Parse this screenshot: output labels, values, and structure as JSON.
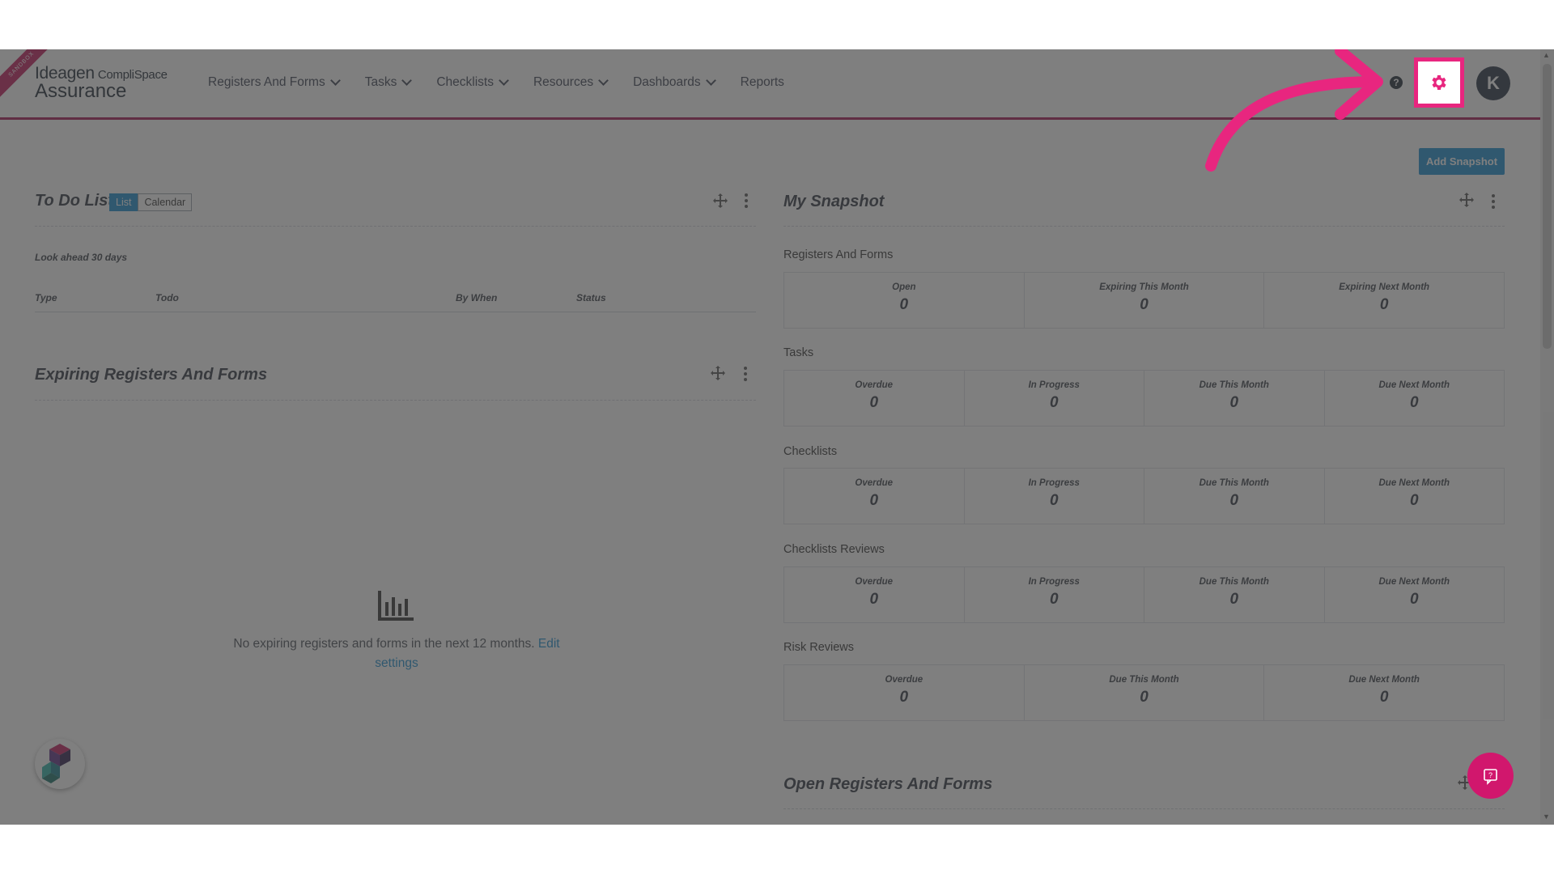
{
  "brand": {
    "sandbox_tag": "SANDBOX",
    "logo_line1": "Ideagen",
    "logo_line1_suffix": "CompliSpace",
    "logo_line2": "Assurance"
  },
  "nav": {
    "items": [
      {
        "label": "Registers And Forms",
        "has_dropdown": true
      },
      {
        "label": "Tasks",
        "has_dropdown": true
      },
      {
        "label": "Checklists",
        "has_dropdown": true
      },
      {
        "label": "Resources",
        "has_dropdown": true
      },
      {
        "label": "Dashboards",
        "has_dropdown": true
      },
      {
        "label": "Reports",
        "has_dropdown": false
      }
    ]
  },
  "header_right": {
    "help_icon": "?",
    "settings_icon": "gear-icon",
    "avatar_initial": "K"
  },
  "actions": {
    "add_snapshot": "Add Snapshot"
  },
  "todo": {
    "title": "To Do List",
    "toggle": [
      {
        "label": "List",
        "active": true
      },
      {
        "label": "Calendar",
        "active": false
      }
    ],
    "look_ahead": "Look ahead 30 days",
    "columns": [
      "Type",
      "Todo",
      "By When",
      "Status"
    ]
  },
  "expiring": {
    "title": "Expiring Registers And Forms",
    "empty_text": "No expiring registers and forms in the next 12 months.",
    "empty_link": "Edit settings"
  },
  "snapshot": {
    "title": "My Snapshot",
    "sections": [
      {
        "label": "Registers And Forms",
        "stats": [
          {
            "label": "Open",
            "value": "0"
          },
          {
            "label": "Expiring This Month",
            "value": "0"
          },
          {
            "label": "Expiring Next Month",
            "value": "0"
          }
        ]
      },
      {
        "label": "Tasks",
        "stats": [
          {
            "label": "Overdue",
            "value": "0"
          },
          {
            "label": "In Progress",
            "value": "0"
          },
          {
            "label": "Due This Month",
            "value": "0"
          },
          {
            "label": "Due Next Month",
            "value": "0"
          }
        ]
      },
      {
        "label": "Checklists",
        "stats": [
          {
            "label": "Overdue",
            "value": "0"
          },
          {
            "label": "In Progress",
            "value": "0"
          },
          {
            "label": "Due This Month",
            "value": "0"
          },
          {
            "label": "Due Next Month",
            "value": "0"
          }
        ]
      },
      {
        "label": "Checklists Reviews",
        "stats": [
          {
            "label": "Overdue",
            "value": "0"
          },
          {
            "label": "In Progress",
            "value": "0"
          },
          {
            "label": "Due This Month",
            "value": "0"
          },
          {
            "label": "Due Next Month",
            "value": "0"
          }
        ]
      },
      {
        "label": "Risk Reviews",
        "stats": [
          {
            "label": "Overdue",
            "value": "0"
          },
          {
            "label": "Due This Month",
            "value": "0"
          },
          {
            "label": "Due Next Month",
            "value": "0"
          }
        ]
      }
    ]
  },
  "open_registers": {
    "title": "Open Registers And Forms"
  },
  "colors": {
    "accent": "#1a8ccf",
    "brand_magenta": "#a3144f",
    "highlight": "#e8267f",
    "chat_button": "#d1176d",
    "overlay": "rgba(60,60,60,0.66)"
  }
}
